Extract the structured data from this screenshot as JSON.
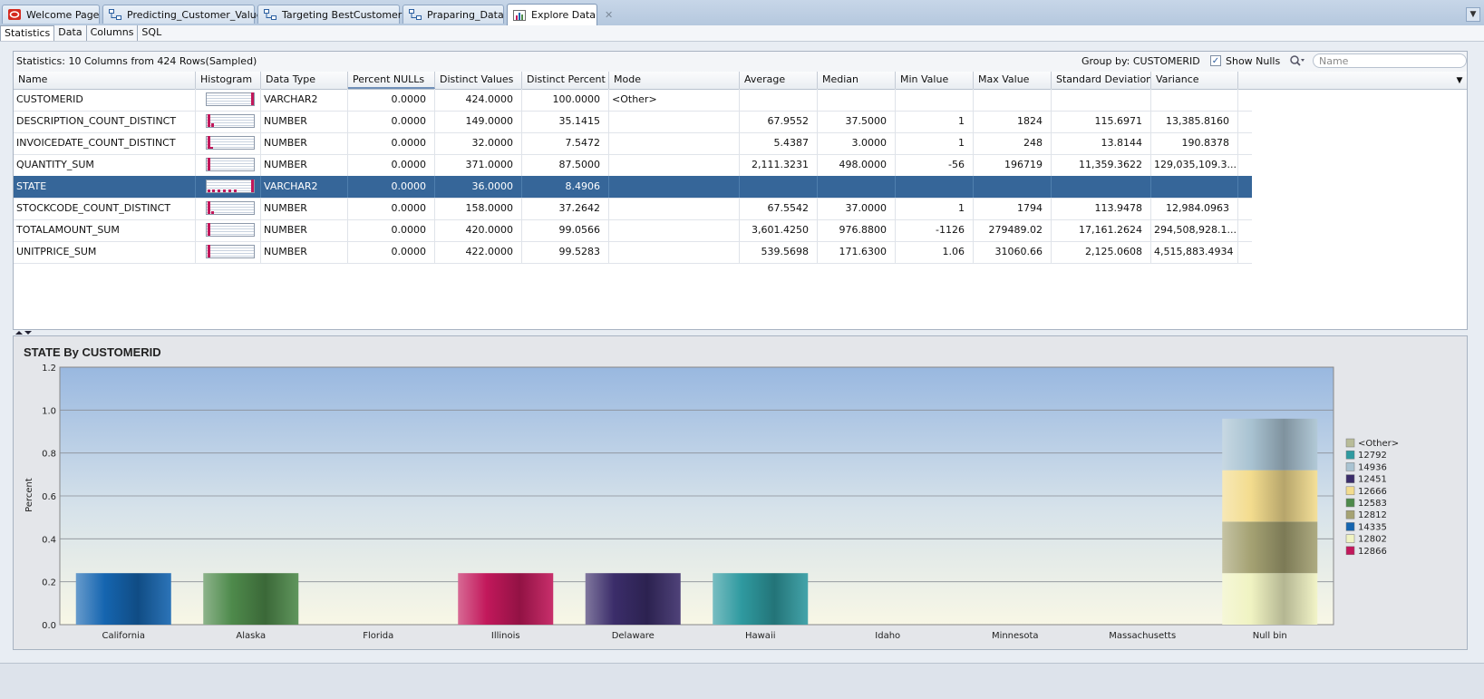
{
  "tabs": [
    {
      "label": "Welcome Page",
      "icon": "oracle-icon"
    },
    {
      "label": "Predicting_Customer_Value",
      "icon": "workflow-icon"
    },
    {
      "label": "Targeting BestCustomers",
      "icon": "workflow-icon"
    },
    {
      "label": "Praparing_Data",
      "icon": "workflow-icon"
    },
    {
      "label": "Explore Data",
      "icon": "explore-data-icon",
      "active": true
    }
  ],
  "subtabs": [
    "Statistics",
    "Data",
    "Columns",
    "SQL"
  ],
  "stats": {
    "summary": "Statistics:  10 Columns from 424  Rows(Sampled)",
    "group_by": "Group by: CUSTOMERID",
    "show_nulls_label": "Show Nulls",
    "show_nulls_checked": true,
    "search_placeholder": "Name"
  },
  "grid": {
    "columns": [
      "Name",
      "Histogram",
      "Data Type",
      "Percent NULLs",
      "Distinct Values",
      "Distinct Percent",
      "Mode",
      "Average",
      "Median",
      "Min Value",
      "Max Value",
      "Standard Deviation",
      "Variance"
    ],
    "rows": [
      {
        "name": "CUSTOMERID",
        "type": "VARCHAR2",
        "pnulls": "0.0000",
        "distinct": "424.0000",
        "dpct": "100.0000",
        "mode": "<Other>",
        "avg": "",
        "median": "",
        "min": "",
        "max": "",
        "std": "",
        "var": ""
      },
      {
        "name": "DESCRIPTION_COUNT_DISTINCT",
        "type": "NUMBER",
        "pnulls": "0.0000",
        "distinct": "149.0000",
        "dpct": "35.1415",
        "mode": "",
        "avg": "67.9552",
        "median": "37.5000",
        "min": "1",
        "max": "1824",
        "std": "115.6971",
        "var": "13,385.8160"
      },
      {
        "name": "INVOICEDATE_COUNT_DISTINCT",
        "type": "NUMBER",
        "pnulls": "0.0000",
        "distinct": "32.0000",
        "dpct": "7.5472",
        "mode": "",
        "avg": "5.4387",
        "median": "3.0000",
        "min": "1",
        "max": "248",
        "std": "13.8144",
        "var": "190.8378"
      },
      {
        "name": "QUANTITY_SUM",
        "type": "NUMBER",
        "pnulls": "0.0000",
        "distinct": "371.0000",
        "dpct": "87.5000",
        "mode": "",
        "avg": "2,111.3231",
        "median": "498.0000",
        "min": "-56",
        "max": "196719",
        "std": "11,359.3622",
        "var": "129,035,109.3..."
      },
      {
        "name": "STATE",
        "type": "VARCHAR2",
        "pnulls": "0.0000",
        "distinct": "36.0000",
        "dpct": "8.4906",
        "mode": "",
        "avg": "",
        "median": "",
        "min": "",
        "max": "",
        "std": "",
        "var": "",
        "selected": true
      },
      {
        "name": "STOCKCODE_COUNT_DISTINCT",
        "type": "NUMBER",
        "pnulls": "0.0000",
        "distinct": "158.0000",
        "dpct": "37.2642",
        "mode": "",
        "avg": "67.5542",
        "median": "37.0000",
        "min": "1",
        "max": "1794",
        "std": "113.9478",
        "var": "12,984.0963"
      },
      {
        "name": "TOTALAMOUNT_SUM",
        "type": "NUMBER",
        "pnulls": "0.0000",
        "distinct": "420.0000",
        "dpct": "99.0566",
        "mode": "",
        "avg": "3,601.4250",
        "median": "976.8800",
        "min": "-1126",
        "max": "279489.02",
        "std": "17,161.2624",
        "var": "294,508,928.1..."
      },
      {
        "name": "UNITPRICE_SUM",
        "type": "NUMBER",
        "pnulls": "0.0000",
        "distinct": "422.0000",
        "dpct": "99.5283",
        "mode": "",
        "avg": "539.5698",
        "median": "171.6300",
        "min": "1.06",
        "max": "31060.66",
        "std": "2,125.0608",
        "var": "4,515,883.4934"
      }
    ]
  },
  "chart_data": {
    "type": "bar",
    "stacked": true,
    "title": "STATE By CUSTOMERID",
    "xlabel": "",
    "ylabel": "Percent",
    "ylim": [
      0,
      1.2
    ],
    "yticks": [
      "0.0",
      "0.2",
      "0.4",
      "0.6",
      "0.8",
      "1.0",
      "1.2"
    ],
    "grid": true,
    "legend_position": "right",
    "categories": [
      "California",
      "Alaska",
      "Florida",
      "Illinois",
      "Delaware",
      "Hawaii",
      "Idaho",
      "Minnesota",
      "Massachusetts",
      "Null bin"
    ],
    "series": [
      {
        "name": "<Other>",
        "color": "#b8bc98",
        "values": [
          0,
          0,
          0,
          0,
          0,
          0,
          0,
          0,
          0,
          0
        ]
      },
      {
        "name": "12792",
        "color": "#2f9aa0",
        "values": [
          0,
          0,
          0,
          0,
          0,
          0,
          0,
          0,
          0,
          0
        ]
      },
      {
        "name": "14936",
        "color": "#a9c3d2",
        "values": [
          0,
          0,
          0,
          0,
          0,
          0,
          0,
          0,
          0,
          0.24
        ]
      },
      {
        "name": "12451",
        "color": "#3b2d6a",
        "values": [
          0,
          0,
          0,
          0,
          0,
          0,
          0,
          0,
          0,
          0
        ]
      },
      {
        "name": "12666",
        "color": "#f3dc8e",
        "values": [
          0,
          0,
          0,
          0,
          0,
          0,
          0,
          0,
          0,
          0.24
        ]
      },
      {
        "name": "12583",
        "color": "#4e8a4b",
        "values": [
          0,
          0,
          0,
          0,
          0,
          0,
          0,
          0,
          0,
          0
        ]
      },
      {
        "name": "12812",
        "color": "#a5a273",
        "values": [
          0,
          0,
          0,
          0,
          0,
          0,
          0,
          0,
          0,
          0.24
        ]
      },
      {
        "name": "14335",
        "color": "#1565b0",
        "values": [
          0,
          0,
          0,
          0,
          0,
          0,
          0,
          0,
          0,
          0
        ]
      },
      {
        "name": "12802",
        "color": "#f0f3c2",
        "values": [
          0,
          0,
          0,
          0,
          0,
          0,
          0,
          0,
          0,
          0.24
        ]
      },
      {
        "name": "12866",
        "color": "#c2185b",
        "values": [
          0,
          0,
          0,
          0,
          0,
          0,
          0,
          0,
          0,
          0
        ]
      }
    ],
    "bars": [
      {
        "category": "California",
        "color": "#1565b0",
        "value": 0.24
      },
      {
        "category": "Alaska",
        "color": "#4e8a4b",
        "value": 0.24
      },
      {
        "category": "Illinois",
        "color": "#c2185b",
        "value": 0.24
      },
      {
        "category": "Delaware",
        "color": "#3b2d6a",
        "value": 0.24
      },
      {
        "category": "Hawaii",
        "color": "#2f9aa0",
        "value": 0.24
      }
    ],
    "null_bin_stack": [
      {
        "name": "12802",
        "color": "#f0f3c2",
        "value": 0.24
      },
      {
        "name": "12812",
        "color": "#a5a273",
        "value": 0.24
      },
      {
        "name": "12666",
        "color": "#f3dc8e",
        "value": 0.24
      },
      {
        "name": "14936",
        "color": "#a9c3d2",
        "value": 0.24
      }
    ]
  }
}
